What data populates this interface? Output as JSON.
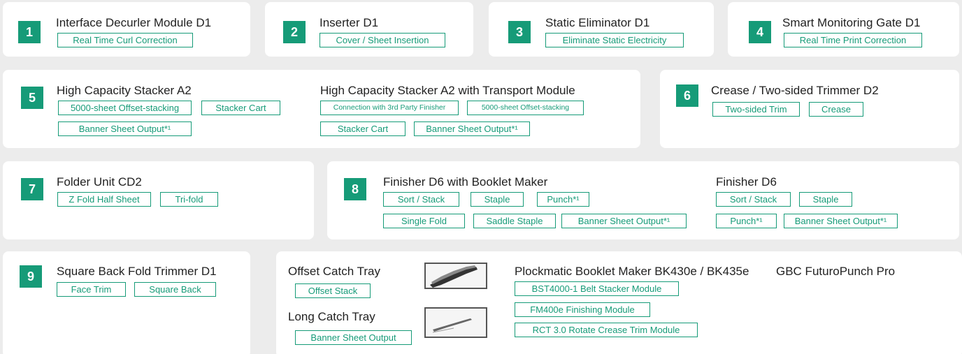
{
  "modules": {
    "m1": {
      "number": "1",
      "title": "Interface Decurler Module D1",
      "tags": [
        "Real Time Curl Correction"
      ]
    },
    "m2": {
      "number": "2",
      "title": "Inserter D1",
      "tags": [
        "Cover / Sheet Insertion"
      ]
    },
    "m3": {
      "number": "3",
      "title": "Static Eliminator D1",
      "tags": [
        "Eliminate Static Electricity"
      ]
    },
    "m4": {
      "number": "4",
      "title": "Smart Monitoring Gate D1",
      "tags": [
        "Real Time Print Correction"
      ]
    },
    "m5": {
      "number": "5",
      "title": "High Capacity Stacker A2",
      "tags": [
        "5000-sheet Offset-stacking",
        "Stacker Cart",
        "Banner Sheet Output*¹"
      ],
      "variant_title": "High Capacity Stacker A2 with Transport Module",
      "variant_tags": [
        "Connection with 3rd Party Finisher",
        "5000-sheet Offset-stacking",
        "Stacker Cart",
        "Banner Sheet Output*¹"
      ]
    },
    "m6": {
      "number": "6",
      "title": "Crease / Two-sided Trimmer D2",
      "tags": [
        "Two-sided Trim",
        "Crease"
      ]
    },
    "m7": {
      "number": "7",
      "title": "Folder Unit CD2",
      "tags": [
        "Z Fold Half Sheet",
        "Tri-fold"
      ]
    },
    "m8": {
      "number": "8",
      "title": "Finisher D6 with Booklet Maker",
      "tags": [
        "Sort / Stack",
        "Staple",
        "Punch*¹",
        "Single Fold",
        "Saddle Staple",
        "Banner Sheet Output*¹"
      ],
      "variant_title": "Finisher D6",
      "variant_tags": [
        "Sort / Stack",
        "Staple",
        "Punch*¹",
        "Banner Sheet Output*¹"
      ]
    },
    "m9": {
      "number": "9",
      "title": "Square Back Fold Trimmer D1",
      "tags": [
        "Face Trim",
        "Square Back"
      ]
    }
  },
  "others": {
    "offset_tray": {
      "title": "Offset Catch Tray",
      "tag": "Offset Stack"
    },
    "long_tray": {
      "title": "Long Catch Tray",
      "tag": "Banner Sheet Output"
    },
    "plockmatic": {
      "title": "Plockmatic Booklet Maker BK430e / BK435e",
      "tags": [
        "BST4000-1 Belt Stacker Module",
        "FM400e Finishing Module",
        "RCT 3.0 Rotate Crease Trim Module"
      ]
    },
    "gbc": {
      "title": "GBC FuturoPunch Pro"
    }
  },
  "colors": {
    "accent": "#169b78",
    "background": "#ececec",
    "card": "#ffffff"
  }
}
